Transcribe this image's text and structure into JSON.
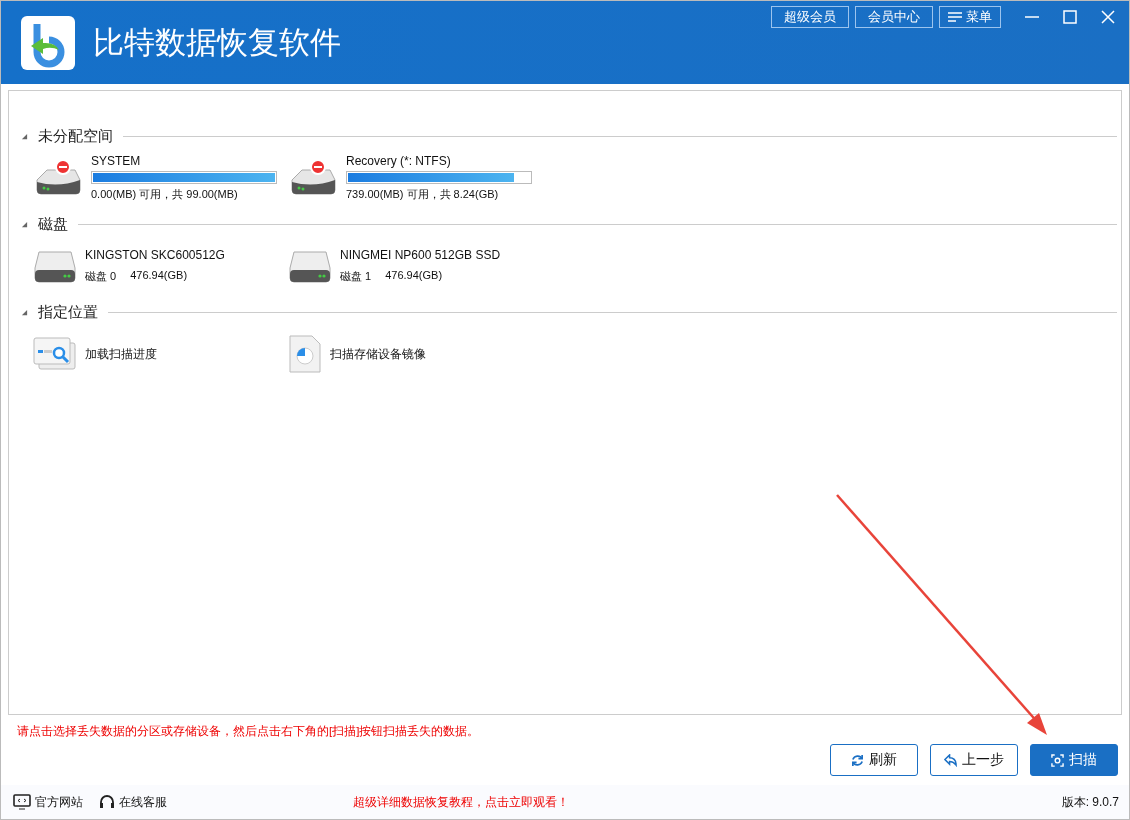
{
  "window": {
    "title": "比特数据恢复软件"
  },
  "header_buttons": [
    {
      "label": "超级会员",
      "kind": "plain"
    },
    {
      "label": "会员中心",
      "kind": "plain"
    },
    {
      "label": "菜单",
      "kind": "menu"
    }
  ],
  "sections": [
    {
      "title": "未分配空间",
      "expanded": true,
      "items": [
        {
          "kind": "partition",
          "name": "SYSTEM",
          "level": 1.0,
          "detail": "0.00(MB) 可用，共 99.00(MB)"
        },
        {
          "kind": "partition",
          "name": "Recovery (*: NTFS)",
          "level": 0.91,
          "detail": "739.00(MB) 可用，共 8.24(GB)"
        }
      ]
    },
    {
      "title": "磁盘",
      "expanded": true,
      "items": [
        {
          "kind": "disk",
          "name": "KINGSTON SKC600512G",
          "disk_label": "磁盘 0",
          "size": "476.94(GB)"
        },
        {
          "kind": "disk",
          "name": "NINGMEI NP600 512GB SSD",
          "disk_label": "磁盘 1",
          "size": "476.94(GB)"
        }
      ]
    },
    {
      "title": "指定位置",
      "expanded": true,
      "items": [
        {
          "kind": "progress",
          "name": "加载扫描进度"
        },
        {
          "kind": "image",
          "name": "扫描存储设备镜像"
        }
      ]
    }
  ],
  "hint": "请点击选择丢失数据的分区或存储设备，然后点击右下角的[扫描]按钮扫描丢失的数据。",
  "buttons": [
    {
      "label": "刷新",
      "kind": "refresh",
      "primary": false
    },
    {
      "label": "上一步",
      "kind": "back",
      "primary": false
    },
    {
      "label": "扫描",
      "kind": "scan",
      "primary": true
    }
  ],
  "footer": {
    "links": [
      {
        "label": "官方网站",
        "kind": "web"
      },
      {
        "label": "在线客服",
        "kind": "support"
      }
    ],
    "promo": "超级详细数据恢复教程，点击立即观看！",
    "version": "版本: 9.0.7"
  }
}
